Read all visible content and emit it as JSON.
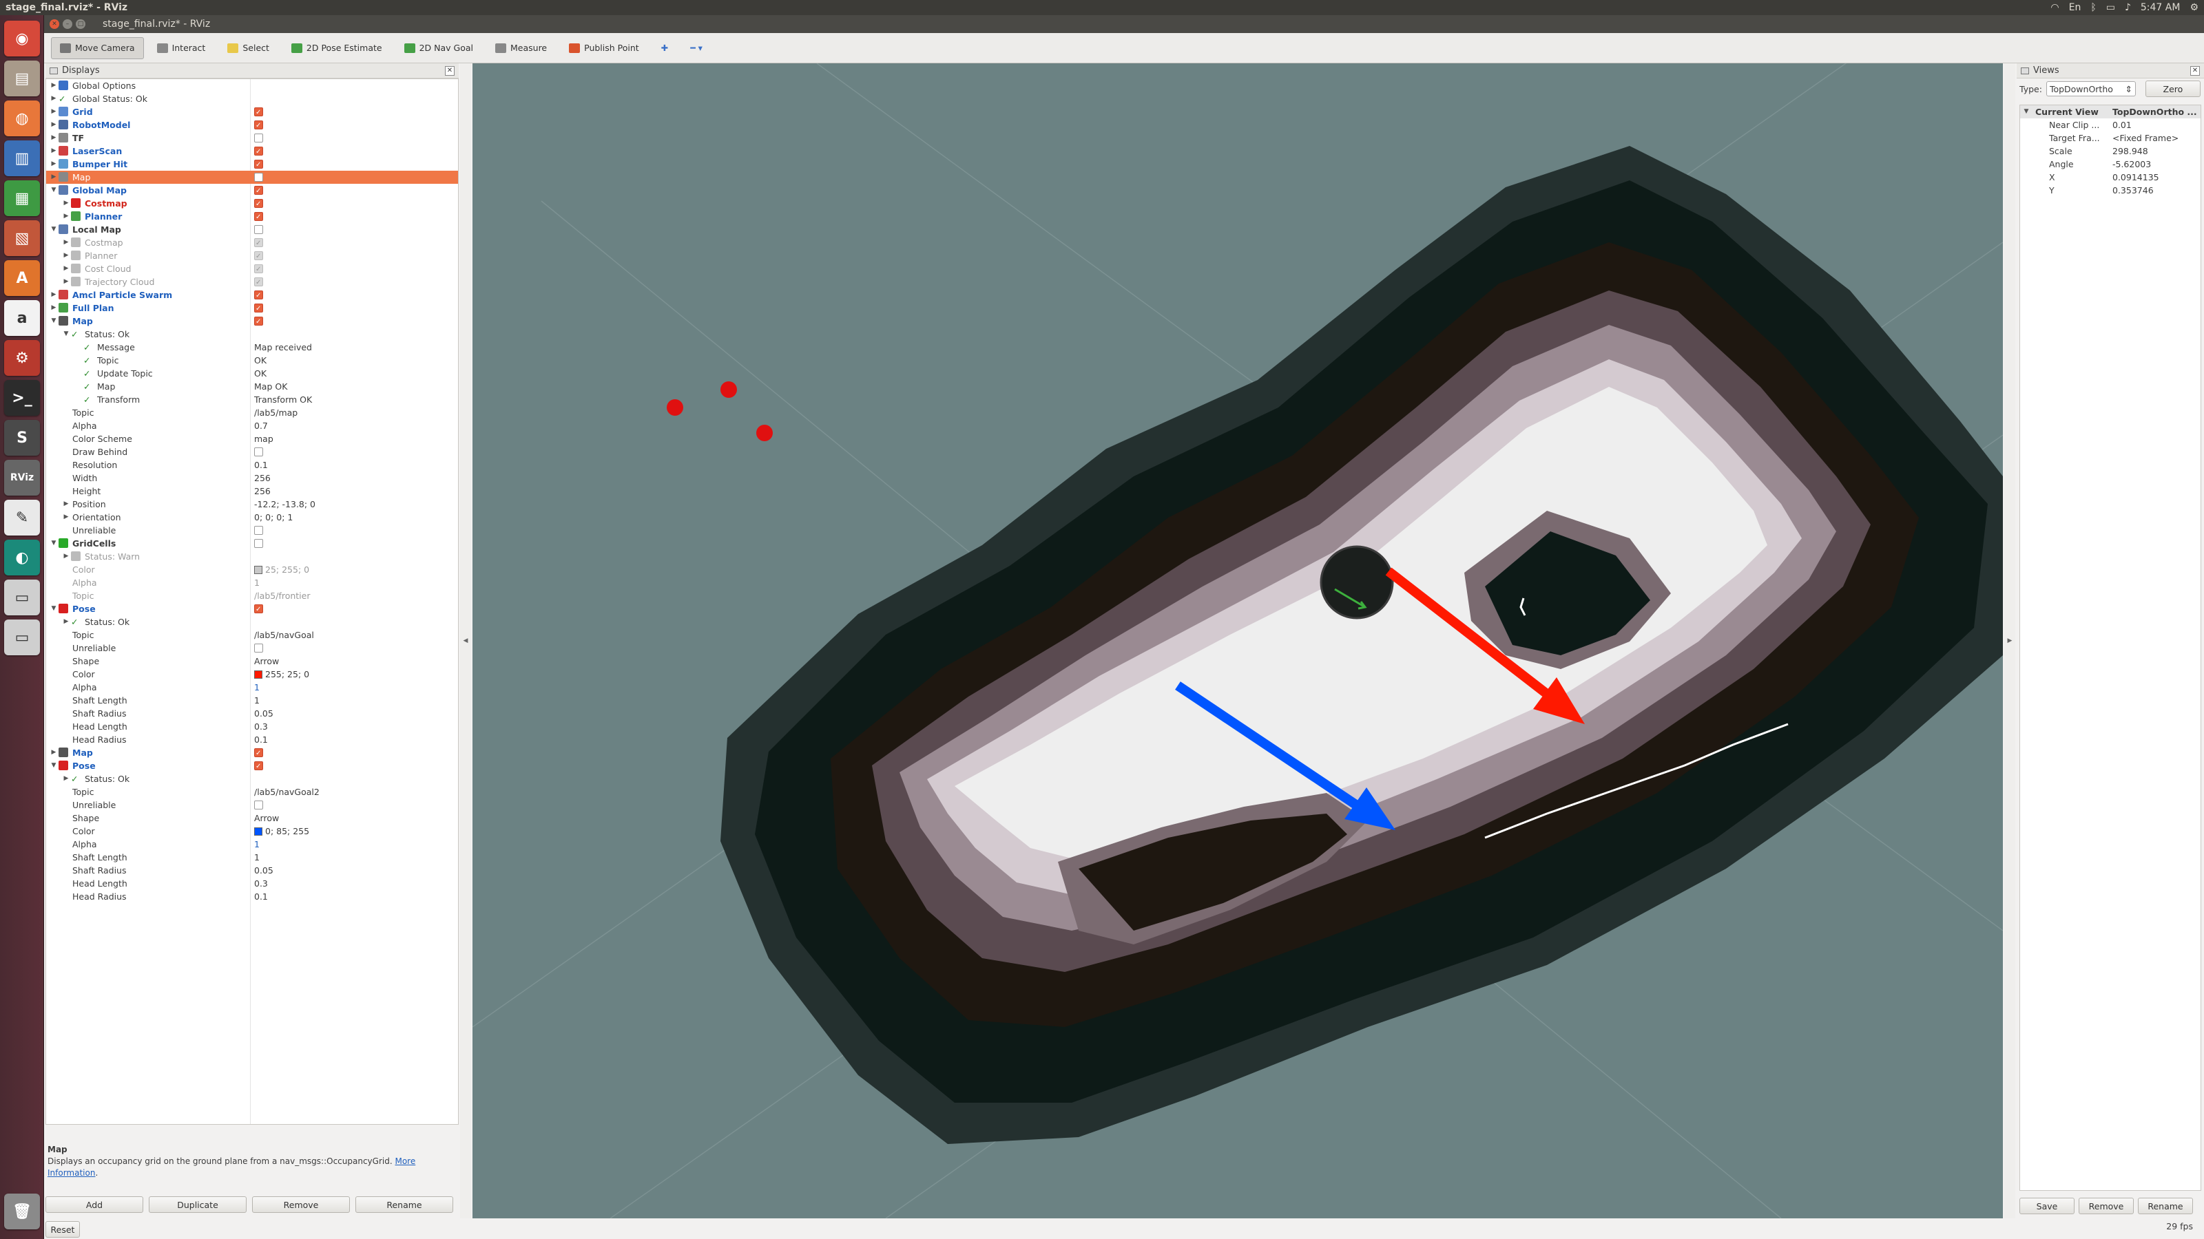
{
  "system": {
    "window_title": "stage_final.rviz* - RViz",
    "clock": "5:47 AM"
  },
  "app": {
    "title": "stage_final.rviz* - RViz"
  },
  "launcher": [
    {
      "name": "dash-icon",
      "color": "#d6493a",
      "glyph": "◉"
    },
    {
      "name": "files-icon",
      "color": "#a89a8a",
      "glyph": "▤"
    },
    {
      "name": "firefox-icon",
      "color": "#e8773a",
      "glyph": "◍"
    },
    {
      "name": "writer-icon",
      "color": "#3b6fb6",
      "glyph": "▥"
    },
    {
      "name": "calc-icon",
      "color": "#3e9a43",
      "glyph": "▦"
    },
    {
      "name": "impress-icon",
      "color": "#c2573a",
      "glyph": "▧"
    },
    {
      "name": "software-center-icon",
      "color": "#e0742c",
      "glyph": "A"
    },
    {
      "name": "amazon-icon",
      "color": "#f2f2f2",
      "glyph": "a"
    },
    {
      "name": "settings-icon",
      "color": "#b73a2e",
      "glyph": "⚙"
    },
    {
      "name": "terminal-icon",
      "color": "#2c2c2c",
      "glyph": ">_"
    },
    {
      "name": "sublime-icon",
      "color": "#4a4a4a",
      "glyph": "S"
    },
    {
      "name": "rviz-icon",
      "color": "#666",
      "glyph": "RViz"
    },
    {
      "name": "editor-icon",
      "color": "#e9e9e9",
      "glyph": "✎"
    },
    {
      "name": "globe-icon",
      "color": "#1b8a7a",
      "glyph": "◐"
    },
    {
      "name": "drive-icon",
      "color": "#cfcfcf",
      "glyph": "▭"
    },
    {
      "name": "drive2-icon",
      "color": "#cfcfcf",
      "glyph": "▭"
    },
    {
      "name": "trash-icon",
      "color": "#8a8a8a",
      "glyph": "🗑"
    }
  ],
  "toolbar": [
    {
      "label": "Move Camera",
      "active": true,
      "icon": "move-camera-icon",
      "color": "#777"
    },
    {
      "label": "Interact",
      "active": false,
      "icon": "interact-icon",
      "color": "#888"
    },
    {
      "label": "Select",
      "active": false,
      "icon": "select-icon",
      "color": "#e8c84a"
    },
    {
      "label": "2D Pose Estimate",
      "active": false,
      "icon": "pose-estimate-icon",
      "color": "#46a046"
    },
    {
      "label": "2D Nav Goal",
      "active": false,
      "icon": "nav-goal-icon",
      "color": "#46a046"
    },
    {
      "label": "Measure",
      "active": false,
      "icon": "measure-icon",
      "color": "#888"
    },
    {
      "label": "Publish Point",
      "active": false,
      "icon": "publish-point-icon",
      "color": "#d9532c"
    }
  ],
  "displays": {
    "title": "Displays",
    "rows": [
      {
        "level": 0,
        "arrow": "▶",
        "icon": "#3a70c8",
        "name": "Global Options",
        "style": "",
        "value": "",
        "cb": ""
      },
      {
        "level": 0,
        "arrow": "▶",
        "icon": "check",
        "name": "Global Status: Ok",
        "style": "",
        "value": "",
        "cb": ""
      },
      {
        "level": 0,
        "arrow": "▶",
        "icon": "#5a8ad0",
        "name": "Grid",
        "style": "blue",
        "value": "",
        "cb": "on"
      },
      {
        "level": 0,
        "arrow": "▶",
        "icon": "#4a6aa0",
        "name": "RobotModel",
        "style": "blue",
        "value": "",
        "cb": "on"
      },
      {
        "level": 0,
        "arrow": "▶",
        "icon": "#888",
        "name": "TF",
        "style": "bold",
        "value": "",
        "cb": "off"
      },
      {
        "level": 0,
        "arrow": "▶",
        "icon": "#d04040",
        "name": "LaserScan",
        "style": "blue",
        "value": "",
        "cb": "on"
      },
      {
        "level": 0,
        "arrow": "▶",
        "icon": "#5a9ad0",
        "name": "Bumper Hit",
        "style": "blue",
        "value": "",
        "cb": "on"
      },
      {
        "level": 0,
        "arrow": "▶",
        "icon": "#888",
        "name": "Map",
        "style": "",
        "value": "",
        "cb": "off",
        "selected": true
      },
      {
        "level": 0,
        "arrow": "▼",
        "icon": "#5a7ab0",
        "name": "Global Map",
        "style": "blue",
        "value": "",
        "cb": "on"
      },
      {
        "level": 1,
        "arrow": "▶",
        "icon": "#d82020",
        "name": "Costmap",
        "style": "red",
        "value": "",
        "cb": "on"
      },
      {
        "level": 1,
        "arrow": "▶",
        "icon": "#46a046",
        "name": "Planner",
        "style": "blue",
        "value": "",
        "cb": "on"
      },
      {
        "level": 0,
        "arrow": "▼",
        "icon": "#5a7ab0",
        "name": "Local Map",
        "style": "bold",
        "value": "",
        "cb": "off"
      },
      {
        "level": 1,
        "arrow": "▶",
        "icon": "#bbb",
        "name": "Costmap",
        "style": "grey",
        "value": "",
        "cb": "dim"
      },
      {
        "level": 1,
        "arrow": "▶",
        "icon": "#bbb",
        "name": "Planner",
        "style": "grey",
        "value": "",
        "cb": "dim"
      },
      {
        "level": 1,
        "arrow": "▶",
        "icon": "#bbb",
        "name": "Cost Cloud",
        "style": "grey",
        "value": "",
        "cb": "dim"
      },
      {
        "level": 1,
        "arrow": "▶",
        "icon": "#bbb",
        "name": "Trajectory Cloud",
        "style": "grey",
        "value": "",
        "cb": "dim"
      },
      {
        "level": 0,
        "arrow": "▶",
        "icon": "#d04040",
        "name": "Amcl Particle Swarm",
        "style": "blue",
        "value": "",
        "cb": "on"
      },
      {
        "level": 0,
        "arrow": "▶",
        "icon": "#46a046",
        "name": "Full Plan",
        "style": "blue",
        "value": "",
        "cb": "on"
      },
      {
        "level": 0,
        "arrow": "▼",
        "icon": "#555",
        "name": "Map",
        "style": "blue",
        "value": "",
        "cb": "on"
      },
      {
        "level": 1,
        "arrow": "▼",
        "icon": "check",
        "name": "Status: Ok",
        "style": "",
        "value": "",
        "cb": ""
      },
      {
        "level": 2,
        "arrow": "",
        "icon": "check",
        "name": "Message",
        "style": "",
        "value": "Map received",
        "cb": ""
      },
      {
        "level": 2,
        "arrow": "",
        "icon": "check",
        "name": "Topic",
        "style": "",
        "value": "OK",
        "cb": ""
      },
      {
        "level": 2,
        "arrow": "",
        "icon": "check",
        "name": "Update Topic",
        "style": "",
        "value": "OK",
        "cb": ""
      },
      {
        "level": 2,
        "arrow": "",
        "icon": "check",
        "name": "Map",
        "style": "",
        "value": "Map OK",
        "cb": ""
      },
      {
        "level": 2,
        "arrow": "",
        "icon": "check",
        "name": "Transform",
        "style": "",
        "value": "Transform OK",
        "cb": ""
      },
      {
        "level": 1,
        "arrow": "",
        "icon": "",
        "name": "Topic",
        "style": "",
        "value": "/lab5/map",
        "cb": ""
      },
      {
        "level": 1,
        "arrow": "",
        "icon": "",
        "name": "Alpha",
        "style": "",
        "value": "0.7",
        "cb": ""
      },
      {
        "level": 1,
        "arrow": "",
        "icon": "",
        "name": "Color Scheme",
        "style": "",
        "value": "map",
        "cb": ""
      },
      {
        "level": 1,
        "arrow": "",
        "icon": "",
        "name": "Draw Behind",
        "style": "",
        "value": "",
        "cb": "off"
      },
      {
        "level": 1,
        "arrow": "",
        "icon": "",
        "name": "Resolution",
        "style": "",
        "value": "0.1",
        "cb": ""
      },
      {
        "level": 1,
        "arrow": "",
        "icon": "",
        "name": "Width",
        "style": "",
        "value": "256",
        "cb": ""
      },
      {
        "level": 1,
        "arrow": "",
        "icon": "",
        "name": "Height",
        "style": "",
        "value": "256",
        "cb": ""
      },
      {
        "level": 1,
        "arrow": "▶",
        "icon": "",
        "name": "Position",
        "style": "",
        "value": "-12.2; -13.8; 0",
        "cb": ""
      },
      {
        "level": 1,
        "arrow": "▶",
        "icon": "",
        "name": "Orientation",
        "style": "",
        "value": "0; 0; 0; 1",
        "cb": ""
      },
      {
        "level": 1,
        "arrow": "",
        "icon": "",
        "name": "Unreliable",
        "style": "",
        "value": "",
        "cb": "off"
      },
      {
        "level": 0,
        "arrow": "▼",
        "icon": "#2aaa2a",
        "name": "GridCells",
        "style": "bold",
        "value": "",
        "cb": "off"
      },
      {
        "level": 1,
        "arrow": "▶",
        "icon": "#bbb",
        "name": "Status: Warn",
        "style": "grey",
        "value": "",
        "cb": ""
      },
      {
        "level": 1,
        "arrow": "",
        "icon": "",
        "name": "Color",
        "style": "grey",
        "value": "25; 255; 0",
        "cb": "",
        "swatch": "#c8c8c8"
      },
      {
        "level": 1,
        "arrow": "",
        "icon": "",
        "name": "Alpha",
        "style": "grey",
        "value": "1",
        "cb": ""
      },
      {
        "level": 1,
        "arrow": "",
        "icon": "",
        "name": "Topic",
        "style": "grey",
        "value": "/lab5/frontier",
        "cb": ""
      },
      {
        "level": 0,
        "arrow": "▼",
        "icon": "#d82020",
        "name": "Pose",
        "style": "blue",
        "value": "",
        "cb": "on"
      },
      {
        "level": 1,
        "arrow": "▶",
        "icon": "check",
        "name": "Status: Ok",
        "style": "",
        "value": "",
        "cb": ""
      },
      {
        "level": 1,
        "arrow": "",
        "icon": "",
        "name": "Topic",
        "style": "",
        "value": "/lab5/navGoal",
        "cb": ""
      },
      {
        "level": 1,
        "arrow": "",
        "icon": "",
        "name": "Unreliable",
        "style": "",
        "value": "",
        "cb": "off"
      },
      {
        "level": 1,
        "arrow": "",
        "icon": "",
        "name": "Shape",
        "style": "",
        "value": "Arrow",
        "cb": ""
      },
      {
        "level": 1,
        "arrow": "",
        "icon": "",
        "name": "Color",
        "style": "",
        "value": "255; 25; 0",
        "cb": "",
        "swatch": "#ff1900"
      },
      {
        "level": 1,
        "arrow": "",
        "icon": "",
        "name": "Alpha",
        "style": "",
        "value": "1",
        "cb": "",
        "valstyle": "blue-text"
      },
      {
        "level": 1,
        "arrow": "",
        "icon": "",
        "name": "Shaft Length",
        "style": "",
        "value": "1",
        "cb": ""
      },
      {
        "level": 1,
        "arrow": "",
        "icon": "",
        "name": "Shaft Radius",
        "style": "",
        "value": "0.05",
        "cb": ""
      },
      {
        "level": 1,
        "arrow": "",
        "icon": "",
        "name": "Head Length",
        "style": "",
        "value": "0.3",
        "cb": ""
      },
      {
        "level": 1,
        "arrow": "",
        "icon": "",
        "name": "Head Radius",
        "style": "",
        "value": "0.1",
        "cb": ""
      },
      {
        "level": 0,
        "arrow": "▶",
        "icon": "#555",
        "name": "Map",
        "style": "blue",
        "value": "",
        "cb": "on"
      },
      {
        "level": 0,
        "arrow": "▼",
        "icon": "#d82020",
        "name": "Pose",
        "style": "blue",
        "value": "",
        "cb": "on"
      },
      {
        "level": 1,
        "arrow": "▶",
        "icon": "check",
        "name": "Status: Ok",
        "style": "",
        "value": "",
        "cb": ""
      },
      {
        "level": 1,
        "arrow": "",
        "icon": "",
        "name": "Topic",
        "style": "",
        "value": "/lab5/navGoal2",
        "cb": ""
      },
      {
        "level": 1,
        "arrow": "",
        "icon": "",
        "name": "Unreliable",
        "style": "",
        "value": "",
        "cb": "off"
      },
      {
        "level": 1,
        "arrow": "",
        "icon": "",
        "name": "Shape",
        "style": "",
        "value": "Arrow",
        "cb": ""
      },
      {
        "level": 1,
        "arrow": "",
        "icon": "",
        "name": "Color",
        "style": "",
        "value": "0; 85; 255",
        "cb": "",
        "swatch": "#0055ff"
      },
      {
        "level": 1,
        "arrow": "",
        "icon": "",
        "name": "Alpha",
        "style": "",
        "value": "1",
        "cb": "",
        "valstyle": "blue-text"
      },
      {
        "level": 1,
        "arrow": "",
        "icon": "",
        "name": "Shaft Length",
        "style": "",
        "value": "1",
        "cb": ""
      },
      {
        "level": 1,
        "arrow": "",
        "icon": "",
        "name": "Shaft Radius",
        "style": "",
        "value": "0.05",
        "cb": ""
      },
      {
        "level": 1,
        "arrow": "",
        "icon": "",
        "name": "Head Length",
        "style": "",
        "value": "0.3",
        "cb": ""
      },
      {
        "level": 1,
        "arrow": "",
        "icon": "",
        "name": "Head Radius",
        "style": "",
        "value": "0.1",
        "cb": ""
      }
    ],
    "help_title": "Map",
    "help_text": "Displays an occupancy grid on the ground plane from a nav_msgs::OccupancyGrid.",
    "help_link": "More Information",
    "buttons": [
      "Add",
      "Duplicate",
      "Remove",
      "Rename"
    ],
    "reset": "Reset"
  },
  "views": {
    "title": "Views",
    "type_label": "Type:",
    "type_value": "TopDownOrtho",
    "zero_label": "Zero",
    "header": {
      "name": "Current View",
      "value": "TopDownOrtho ..."
    },
    "props": [
      {
        "name": "Near Clip ...",
        "value": "0.01"
      },
      {
        "name": "Target Fra...",
        "value": "<Fixed Frame>"
      },
      {
        "name": "Scale",
        "value": "298.948"
      },
      {
        "name": "Angle",
        "value": "-5.62003"
      },
      {
        "name": "X",
        "value": "0.0914135"
      },
      {
        "name": "Y",
        "value": "0.353746"
      }
    ],
    "buttons": [
      "Save",
      "Remove",
      "Rename"
    ]
  },
  "status": {
    "fps": "29 fps"
  },
  "scene": {
    "colors": {
      "background": "#6b8283",
      "outer": "#2a3b3b",
      "dark": "#0d1a17",
      "inner_dark": "#1e1710",
      "gradient": [
        "#4a3a3e",
        "#7a6a70",
        "#a898a0",
        "#d4cad0",
        "#eeeeee"
      ],
      "red_arrow": "#ff1900",
      "blue_arrow": "#0055ff"
    }
  }
}
